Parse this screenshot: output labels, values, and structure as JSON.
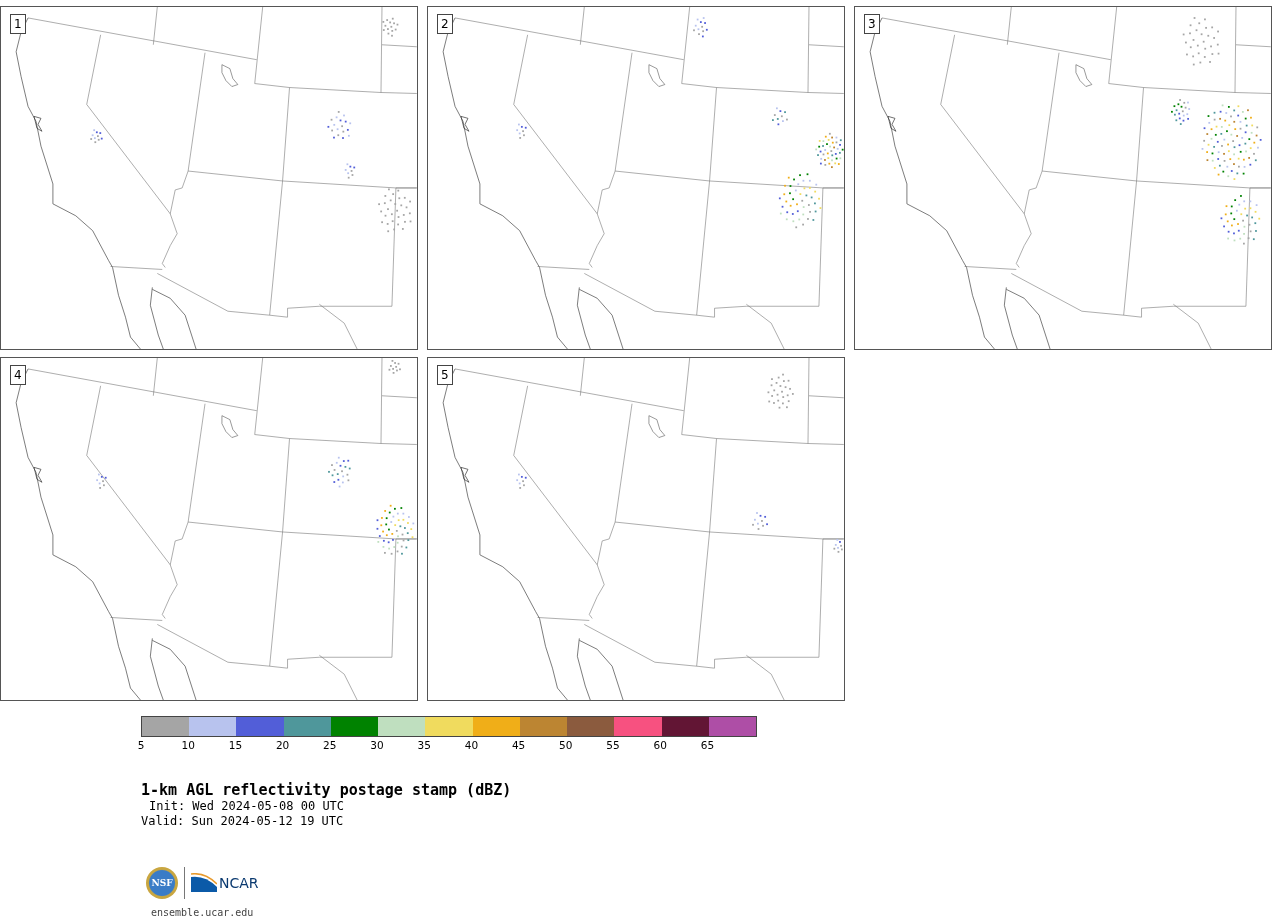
{
  "panels": [
    {
      "label": "1"
    },
    {
      "label": "2"
    },
    {
      "label": "3"
    },
    {
      "label": "4"
    },
    {
      "label": "5"
    }
  ],
  "colorbar": {
    "bins": [
      {
        "color": "#a5a5a5"
      },
      {
        "color": "#b8c3ee"
      },
      {
        "color": "#525ed8"
      },
      {
        "color": "#4f979b"
      },
      {
        "color": "#008200"
      },
      {
        "color": "#bfdfbf"
      },
      {
        "color": "#f0db5e"
      },
      {
        "color": "#f0ae18"
      },
      {
        "color": "#bc8532"
      },
      {
        "color": "#8b5b3e"
      },
      {
        "color": "#f75180"
      },
      {
        "color": "#621534"
      },
      {
        "color": "#ae4ea6"
      }
    ],
    "ticks": [
      "5",
      "10",
      "15",
      "20",
      "25",
      "30",
      "35",
      "40",
      "45",
      "50",
      "55",
      "60",
      "65"
    ]
  },
  "title": "1-km AGL reflectivity postage stamp (dBZ)",
  "init": "Init: Wed 2024-05-08 00 UTC",
  "valid": "Valid: Sun 2024-05-12 19 UTC",
  "logo": {
    "nsf": "NSF",
    "ncar": "NCAR"
  },
  "url": "ensemble.ucar.edu"
}
